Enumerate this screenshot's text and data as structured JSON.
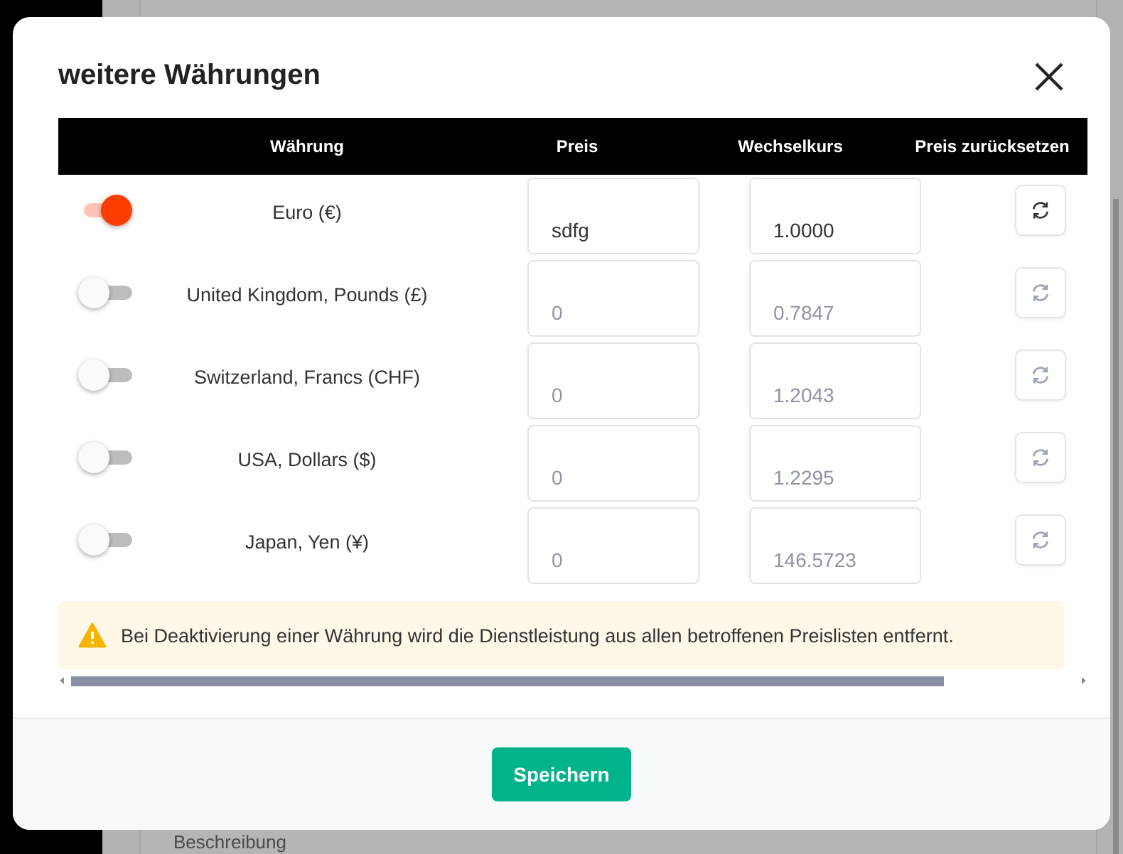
{
  "background": {
    "label": "Beschreibung"
  },
  "dialog": {
    "title": "weitere Währungen",
    "table": {
      "columns": [
        "Währung",
        "Preis",
        "Wechselkurs",
        "Preis zurücksetzen"
      ],
      "rows": [
        {
          "on": true,
          "currency": "Euro (€)",
          "price": "sdfg",
          "rate": "1.0000"
        },
        {
          "on": false,
          "currency": "United Kingdom, Pounds (£)",
          "price": "0",
          "rate": "0.7847"
        },
        {
          "on": false,
          "currency": "Switzerland, Francs (CHF)",
          "price": "0",
          "rate": "1.2043"
        },
        {
          "on": false,
          "currency": "USA, Dollars ($)",
          "price": "0",
          "rate": "1.2295"
        },
        {
          "on": false,
          "currency": "Japan, Yen (¥)",
          "price": "0",
          "rate": "146.5723"
        }
      ]
    },
    "warning": "Bei Deaktivierung einer Währung wird die Dienstleistung aus allen betroffenen Preislisten entfernt.",
    "save_button": "Speichern"
  }
}
